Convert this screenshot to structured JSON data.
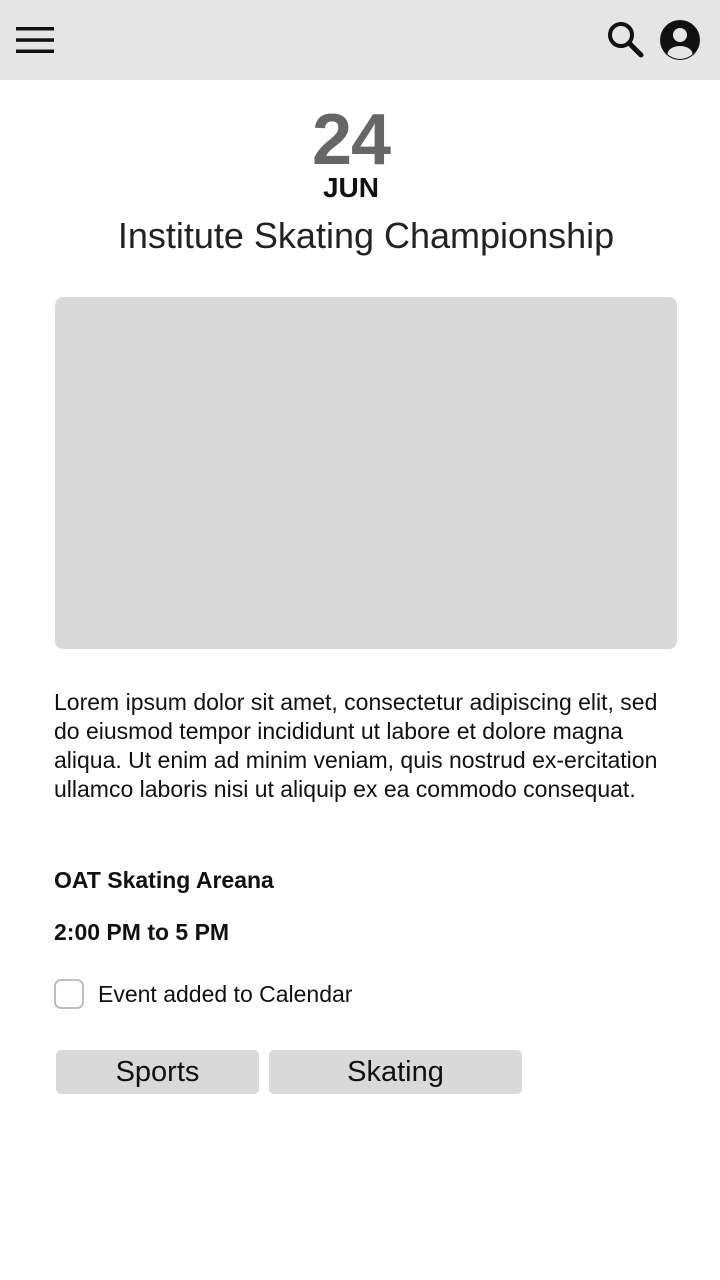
{
  "header": {
    "menu_icon": "hamburger-menu-icon",
    "search_icon": "search-icon",
    "account_icon": "account-circle-icon",
    "background": "#e5e5e5"
  },
  "event": {
    "day": "24",
    "month": "JUN",
    "title": "Institute Skating Championship",
    "description": "Lorem ipsum dolor sit amet, consectetur adipiscing elit, sed do eiusmod tempor incididunt ut labore et dolore magna aliqua. Ut enim ad minim veniam, quis nostrud ex-ercitation ullamco laboris nisi ut aliquip ex ea commodo consequat.",
    "venue": "OAT Skating Areana",
    "time": "2:00 PM to 5 PM",
    "calendar": {
      "label": "Event added to Calendar",
      "checked": false
    },
    "tags": [
      "Sports",
      "Skating"
    ]
  },
  "colors": {
    "placeholder": "#d9d9d9",
    "date_day": "#666666",
    "text": "#111111"
  }
}
